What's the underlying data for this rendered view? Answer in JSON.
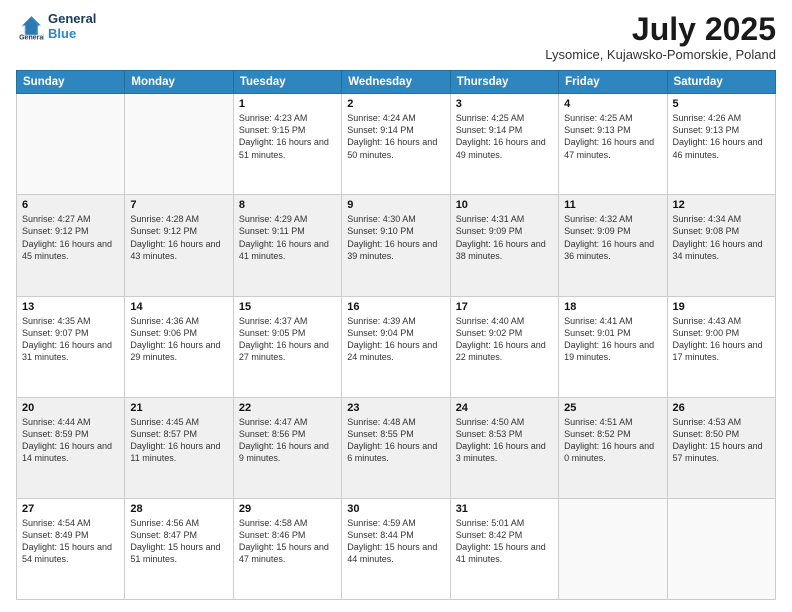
{
  "logo": {
    "line1": "General",
    "line2": "Blue"
  },
  "title": "July 2025",
  "subtitle": "Lysomice, Kujawsko-Pomorskie, Poland",
  "days_of_week": [
    "Sunday",
    "Monday",
    "Tuesday",
    "Wednesday",
    "Thursday",
    "Friday",
    "Saturday"
  ],
  "weeks": [
    [
      {
        "day": "",
        "sunrise": "",
        "sunset": "",
        "daylight": ""
      },
      {
        "day": "",
        "sunrise": "",
        "sunset": "",
        "daylight": ""
      },
      {
        "day": "1",
        "sunrise": "Sunrise: 4:23 AM",
        "sunset": "Sunset: 9:15 PM",
        "daylight": "Daylight: 16 hours and 51 minutes."
      },
      {
        "day": "2",
        "sunrise": "Sunrise: 4:24 AM",
        "sunset": "Sunset: 9:14 PM",
        "daylight": "Daylight: 16 hours and 50 minutes."
      },
      {
        "day": "3",
        "sunrise": "Sunrise: 4:25 AM",
        "sunset": "Sunset: 9:14 PM",
        "daylight": "Daylight: 16 hours and 49 minutes."
      },
      {
        "day": "4",
        "sunrise": "Sunrise: 4:25 AM",
        "sunset": "Sunset: 9:13 PM",
        "daylight": "Daylight: 16 hours and 47 minutes."
      },
      {
        "day": "5",
        "sunrise": "Sunrise: 4:26 AM",
        "sunset": "Sunset: 9:13 PM",
        "daylight": "Daylight: 16 hours and 46 minutes."
      }
    ],
    [
      {
        "day": "6",
        "sunrise": "Sunrise: 4:27 AM",
        "sunset": "Sunset: 9:12 PM",
        "daylight": "Daylight: 16 hours and 45 minutes."
      },
      {
        "day": "7",
        "sunrise": "Sunrise: 4:28 AM",
        "sunset": "Sunset: 9:12 PM",
        "daylight": "Daylight: 16 hours and 43 minutes."
      },
      {
        "day": "8",
        "sunrise": "Sunrise: 4:29 AM",
        "sunset": "Sunset: 9:11 PM",
        "daylight": "Daylight: 16 hours and 41 minutes."
      },
      {
        "day": "9",
        "sunrise": "Sunrise: 4:30 AM",
        "sunset": "Sunset: 9:10 PM",
        "daylight": "Daylight: 16 hours and 39 minutes."
      },
      {
        "day": "10",
        "sunrise": "Sunrise: 4:31 AM",
        "sunset": "Sunset: 9:09 PM",
        "daylight": "Daylight: 16 hours and 38 minutes."
      },
      {
        "day": "11",
        "sunrise": "Sunrise: 4:32 AM",
        "sunset": "Sunset: 9:09 PM",
        "daylight": "Daylight: 16 hours and 36 minutes."
      },
      {
        "day": "12",
        "sunrise": "Sunrise: 4:34 AM",
        "sunset": "Sunset: 9:08 PM",
        "daylight": "Daylight: 16 hours and 34 minutes."
      }
    ],
    [
      {
        "day": "13",
        "sunrise": "Sunrise: 4:35 AM",
        "sunset": "Sunset: 9:07 PM",
        "daylight": "Daylight: 16 hours and 31 minutes."
      },
      {
        "day": "14",
        "sunrise": "Sunrise: 4:36 AM",
        "sunset": "Sunset: 9:06 PM",
        "daylight": "Daylight: 16 hours and 29 minutes."
      },
      {
        "day": "15",
        "sunrise": "Sunrise: 4:37 AM",
        "sunset": "Sunset: 9:05 PM",
        "daylight": "Daylight: 16 hours and 27 minutes."
      },
      {
        "day": "16",
        "sunrise": "Sunrise: 4:39 AM",
        "sunset": "Sunset: 9:04 PM",
        "daylight": "Daylight: 16 hours and 24 minutes."
      },
      {
        "day": "17",
        "sunrise": "Sunrise: 4:40 AM",
        "sunset": "Sunset: 9:02 PM",
        "daylight": "Daylight: 16 hours and 22 minutes."
      },
      {
        "day": "18",
        "sunrise": "Sunrise: 4:41 AM",
        "sunset": "Sunset: 9:01 PM",
        "daylight": "Daylight: 16 hours and 19 minutes."
      },
      {
        "day": "19",
        "sunrise": "Sunrise: 4:43 AM",
        "sunset": "Sunset: 9:00 PM",
        "daylight": "Daylight: 16 hours and 17 minutes."
      }
    ],
    [
      {
        "day": "20",
        "sunrise": "Sunrise: 4:44 AM",
        "sunset": "Sunset: 8:59 PM",
        "daylight": "Daylight: 16 hours and 14 minutes."
      },
      {
        "day": "21",
        "sunrise": "Sunrise: 4:45 AM",
        "sunset": "Sunset: 8:57 PM",
        "daylight": "Daylight: 16 hours and 11 minutes."
      },
      {
        "day": "22",
        "sunrise": "Sunrise: 4:47 AM",
        "sunset": "Sunset: 8:56 PM",
        "daylight": "Daylight: 16 hours and 9 minutes."
      },
      {
        "day": "23",
        "sunrise": "Sunrise: 4:48 AM",
        "sunset": "Sunset: 8:55 PM",
        "daylight": "Daylight: 16 hours and 6 minutes."
      },
      {
        "day": "24",
        "sunrise": "Sunrise: 4:50 AM",
        "sunset": "Sunset: 8:53 PM",
        "daylight": "Daylight: 16 hours and 3 minutes."
      },
      {
        "day": "25",
        "sunrise": "Sunrise: 4:51 AM",
        "sunset": "Sunset: 8:52 PM",
        "daylight": "Daylight: 16 hours and 0 minutes."
      },
      {
        "day": "26",
        "sunrise": "Sunrise: 4:53 AM",
        "sunset": "Sunset: 8:50 PM",
        "daylight": "Daylight: 15 hours and 57 minutes."
      }
    ],
    [
      {
        "day": "27",
        "sunrise": "Sunrise: 4:54 AM",
        "sunset": "Sunset: 8:49 PM",
        "daylight": "Daylight: 15 hours and 54 minutes."
      },
      {
        "day": "28",
        "sunrise": "Sunrise: 4:56 AM",
        "sunset": "Sunset: 8:47 PM",
        "daylight": "Daylight: 15 hours and 51 minutes."
      },
      {
        "day": "29",
        "sunrise": "Sunrise: 4:58 AM",
        "sunset": "Sunset: 8:46 PM",
        "daylight": "Daylight: 15 hours and 47 minutes."
      },
      {
        "day": "30",
        "sunrise": "Sunrise: 4:59 AM",
        "sunset": "Sunset: 8:44 PM",
        "daylight": "Daylight: 15 hours and 44 minutes."
      },
      {
        "day": "31",
        "sunrise": "Sunrise: 5:01 AM",
        "sunset": "Sunset: 8:42 PM",
        "daylight": "Daylight: 15 hours and 41 minutes."
      },
      {
        "day": "",
        "sunrise": "",
        "sunset": "",
        "daylight": ""
      },
      {
        "day": "",
        "sunrise": "",
        "sunset": "",
        "daylight": ""
      }
    ]
  ]
}
